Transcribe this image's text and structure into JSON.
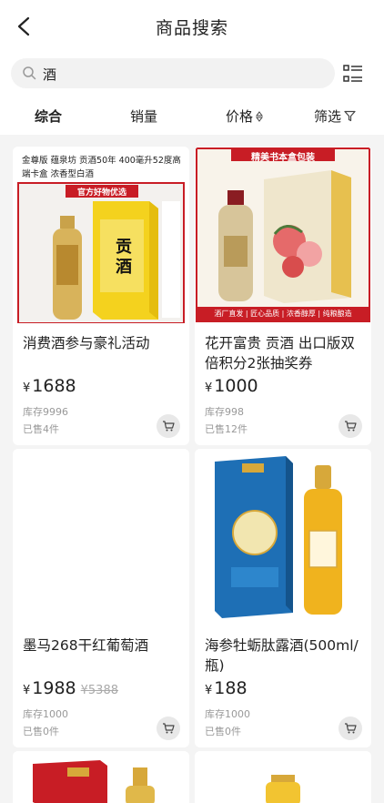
{
  "header": {
    "title": "商品搜索"
  },
  "search": {
    "query": "酒"
  },
  "tabs": [
    {
      "label": "综合"
    },
    {
      "label": "销量"
    },
    {
      "label": "价格"
    },
    {
      "label": "筛选"
    }
  ],
  "products": [
    {
      "image_text": {
        "top": "金尊版 蕴泉坊 贡酒50年 400毫升52度高端卡盒 浓香型白酒",
        "banner": "官方好物优选",
        "box": "贡酒"
      },
      "name": "消费酒参与豪礼活动",
      "currency": "¥",
      "price": "1688",
      "stock": "库存9996",
      "sold": "已售4件"
    },
    {
      "image_text": {
        "banner": "精美书本盒包装",
        "bottom": "酒厂直发 | 匠心品质 | 浓香醇厚 | 纯粮酿造"
      },
      "name": "花开富贵 贡酒 出口版双倍积分2张抽奖券",
      "currency": "¥",
      "price": "1000",
      "stock": "库存998",
      "sold": "已售12件"
    },
    {
      "name": "墨马268干红葡萄酒",
      "currency": "¥",
      "price": "1988",
      "original_price": "¥5388",
      "stock": "库存1000",
      "sold": "已售0件"
    },
    {
      "name": "海参牡蛎肽露酒(500ml/瓶)",
      "currency": "¥",
      "price": "188",
      "stock": "库存1000",
      "sold": "已售0件"
    }
  ],
  "colors": {
    "accent_red": "#c81d25",
    "gold": "#d7a83a",
    "blue_box": "#1e6fb5",
    "yellow_box": "#f4d21e"
  }
}
